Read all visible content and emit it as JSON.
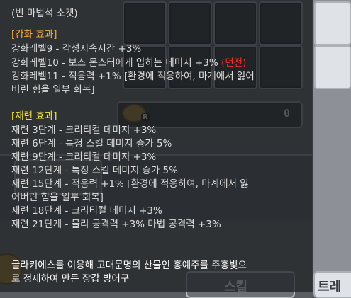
{
  "background": {
    "gold_value": "0",
    "coin_tag": "R",
    "bottom_button_1": "스킬",
    "bottom_button_2": "트레"
  },
  "tooltip": {
    "socket_line": "(빈 마법석 소켓)",
    "enhance_header": "[강화 효과]",
    "enhance_lines": [
      "강화레벨9 - 각성지속시간 +3%",
      "강화레벨10 - 보스 몬스터에게 입히는 데미지 +3%",
      "강화레벨11 - 적응력 +1% [환경에 적응하여, 마계에서 잃어",
      "버린 힘을 일부 회복]"
    ],
    "enhance_line10_tag": "(던전)",
    "refine_header": "[재련 효과]",
    "refine_lines": [
      "재련 3단계 - 크리티컬 데미지 +3%",
      "재련 6단계 - 특정 스킬 데미지 증가 5%",
      "재련 9단계 - 크리티컬 데미지 +3%",
      "재련 12단계 - 특정 스킬 데미지 증가 5%",
      "재련 15단계 - 적응력 +1% [환경에 적응하여, 마계에서 잃",
      "어버린 힘을 일부 회복]",
      "재련 18단계 - 크리티컬 데미지 +3%",
      "재련 21단계 - 물리 공격력 +3% 마법 공격력 +3%"
    ],
    "description_lines": [
      "글라키에스를 이용해 고대문명의 산물인 홍예주를 주홍빛으",
      "로 정제하여 만든 장갑 방어구"
    ]
  },
  "colors": {
    "enhance_header": "#f2a93b",
    "refine_header": "#f3e233",
    "dungeon_tag": "#ff2a2a",
    "body_text": "#dcdcdc",
    "description_text": "#ffffff"
  }
}
